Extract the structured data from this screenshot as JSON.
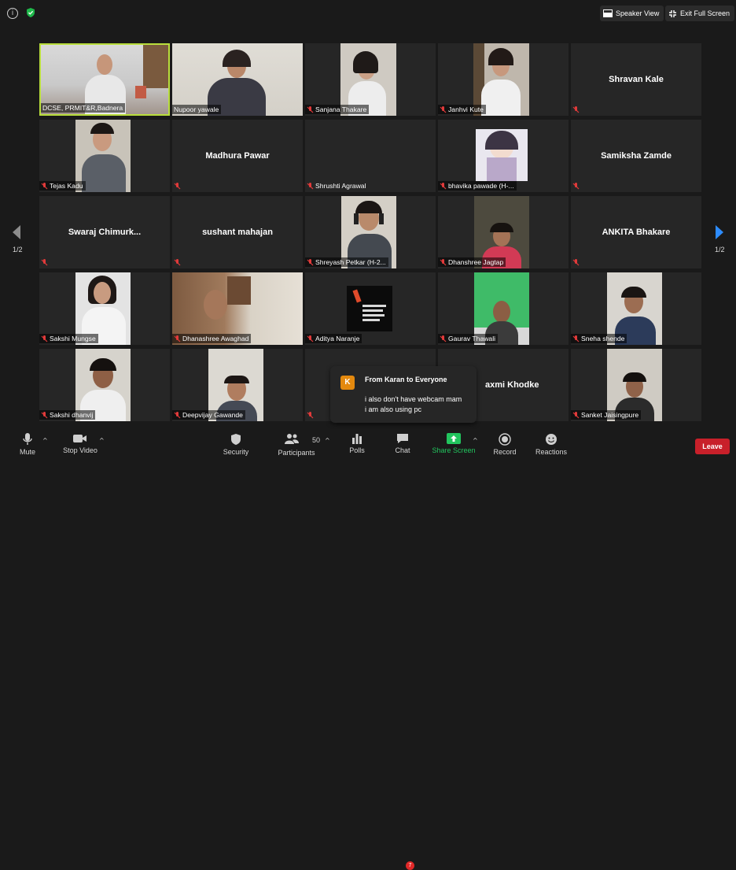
{
  "topbar": {
    "info_icon": "i",
    "speaker_view": "Speaker View",
    "exit_full_screen": "Exit Full Screen",
    "security_color": "#1fb84a"
  },
  "pagination": {
    "left": "1/2",
    "right": "1/2"
  },
  "participants": [
    {
      "name": "DCSE, PRMIT&R,Badnera",
      "video": true,
      "active": true
    },
    {
      "name": "Nupoor yawale",
      "video": true
    },
    {
      "name": "Sanjana Thakare",
      "video": true
    },
    {
      "name": "Janhvi Kute",
      "video": true
    },
    {
      "name": "Shravan Kale",
      "video": false
    },
    {
      "name": "Tejas Kadu",
      "video": true
    },
    {
      "name": "Madhura Pawar",
      "video": false
    },
    {
      "name": "Shrushti Agrawal",
      "video": false,
      "show_name_only_label": true
    },
    {
      "name": "bhavika pawade (H-...",
      "video": true
    },
    {
      "name": "Samiksha Zamde",
      "video": false
    },
    {
      "name": "Swaraj  Chimurk...",
      "video": false
    },
    {
      "name": "sushant mahajan",
      "video": false
    },
    {
      "name": "Shreyash Petkar (H-2...",
      "video": true
    },
    {
      "name": "Dhanshree Jagtap",
      "video": true
    },
    {
      "name": "ANKITA Bhakare",
      "video": false
    },
    {
      "name": "Sakshi Mungse",
      "video": true
    },
    {
      "name": "Dhanashree Awaghad",
      "video": true
    },
    {
      "name": "Aditya Naranje",
      "video": true
    },
    {
      "name": "Gaurav Thawali",
      "video": true
    },
    {
      "name": "Sneha shende",
      "video": true
    },
    {
      "name": "Sakshi dhanvij",
      "video": true
    },
    {
      "name": "Deepvijay Gawande",
      "video": true
    },
    {
      "name": "",
      "video": false
    },
    {
      "name": "axmi Khodke",
      "video": false
    },
    {
      "name": "Sanket Jaisingpure",
      "video": true
    }
  ],
  "chat_popup": {
    "avatar": "K",
    "from": "From Karan to Everyone",
    "line1": "i also don't have webcam mam",
    "line2": "i am also using pc"
  },
  "toolbar": {
    "mute": "Mute",
    "stop_video": "Stop Video",
    "security": "Security",
    "participants_count": "50",
    "participants": "Participants",
    "polls": "Polls",
    "chat": "Chat",
    "chat_badge": "7",
    "share_screen": "Share Screen",
    "record": "Record",
    "reactions": "Reactions",
    "leave": "Leave",
    "share_color": "#22c55e",
    "leave_color": "#c8202a"
  }
}
